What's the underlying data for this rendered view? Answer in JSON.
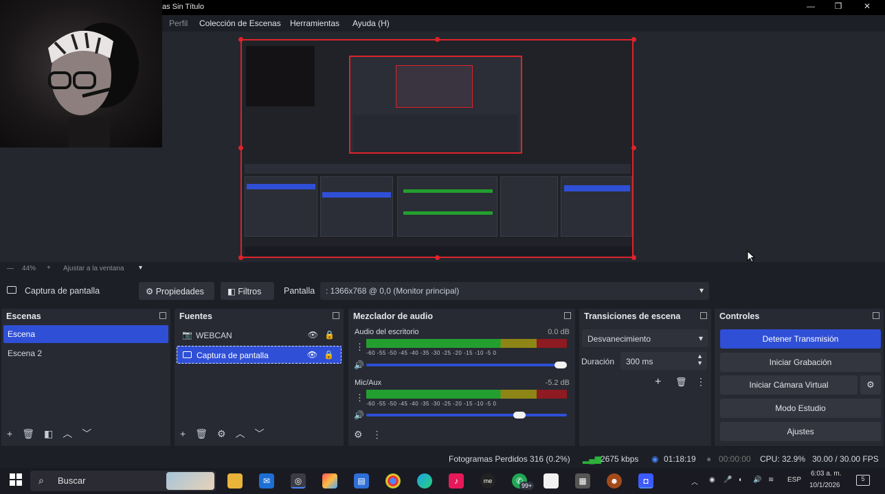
{
  "window": {
    "title": "as Sin Título",
    "minimize": "—",
    "maximize": "❐",
    "close": "✕"
  },
  "menu": {
    "items": [
      "Perfil",
      "Colección de Escenas",
      "Herramientas",
      "Ayuda (H)"
    ]
  },
  "zoom": {
    "value": "44%",
    "plus": "+",
    "fit_label": "Ajustar a la ventana"
  },
  "source_toolbar": {
    "selected_source": "Captura de pantalla",
    "properties_label": "Propiedades",
    "filters_label": "Filtros",
    "display_label": "Pantalla",
    "display_value": ": 1366x768 @ 0,0 (Monitor principal)"
  },
  "scenes": {
    "title": "Escenas",
    "items": [
      "Escena",
      "Escena 2"
    ]
  },
  "sources": {
    "title": "Fuentes",
    "items": [
      "WEBCAN",
      "Captura de pantalla"
    ]
  },
  "mixer": {
    "title": "Mezclador de audio",
    "channels": [
      {
        "name": "Audio del escritorio",
        "db": "0.0 dB",
        "volume": 1.0
      },
      {
        "name": "Mic/Aux",
        "db": "-5.2 dB",
        "volume": 0.78
      }
    ],
    "ticks": "-60  -55  -50  -45  -40  -35  -30  -25  -20  -15  -10   -5    0"
  },
  "transitions": {
    "title": "Transiciones de escena",
    "selected": "Desvanecimiento",
    "duration_label": "Duración",
    "duration_value": "300 ms"
  },
  "controls": {
    "title": "Controles",
    "buttons": [
      "Detener Transmisión",
      "Iniciar Grabación",
      "Iniciar Cámara Virtual",
      "Modo Estudio",
      "Ajustes"
    ]
  },
  "status": {
    "dropped_frames": "Fotogramas Perdidos 316 (0.2%)",
    "bitrate": "2675 kbps",
    "live_time": "01:18:19",
    "rec_time": "00:00:00",
    "cpu": "CPU: 32.9%",
    "fps": "30.00 / 30.00 FPS"
  },
  "taskbar": {
    "search_placeholder": "Buscar",
    "badge": "99+",
    "language": "ESP",
    "time": "6:03 a. m.",
    "date": "10/1/2026",
    "notif_count": "5"
  },
  "colors": {
    "accent": "#2f4fd6",
    "selection_border": "#e0222a",
    "panel": "#272a33",
    "background": "#1d1f26"
  }
}
